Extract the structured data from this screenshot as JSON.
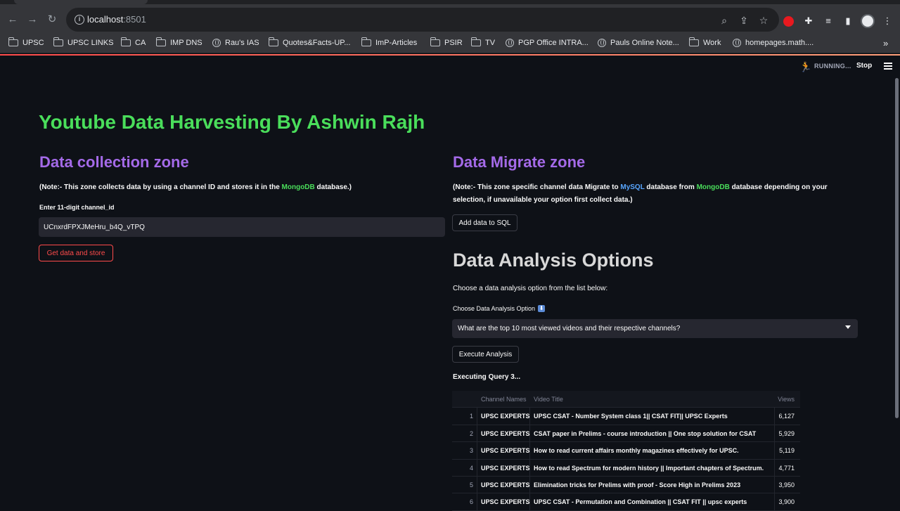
{
  "browser": {
    "url_host": "localhost",
    "url_port": ":8501",
    "bookmarks": [
      {
        "label": "UPSC",
        "icon": "folder-icon"
      },
      {
        "label": "UPSC LINKS",
        "icon": "folder-icon"
      },
      {
        "label": "CA",
        "icon": "folder-icon"
      },
      {
        "label": "IMP DNS",
        "icon": "folder-icon"
      },
      {
        "label": "Rau's IAS",
        "icon": "globe-icon"
      },
      {
        "label": "Quotes&Facts-UP...",
        "icon": "folder-icon"
      },
      {
        "label": "ImP-Articles",
        "icon": "folder-icon"
      },
      {
        "label": "PSIR",
        "icon": "folder-icon"
      },
      {
        "label": "TV",
        "icon": "folder-icon"
      },
      {
        "label": "PGP Office INTRA...",
        "icon": "globe-icon"
      },
      {
        "label": "Pauls Online Note...",
        "icon": "globe-icon"
      },
      {
        "label": "Work",
        "icon": "folder-icon"
      },
      {
        "label": "homepages.math....",
        "icon": "globe-icon"
      }
    ],
    "more_label": "»"
  },
  "status": {
    "running_label": "RUNNING...",
    "stop_label": "Stop"
  },
  "app": {
    "title": "Youtube Data Harvesting By Ashwin Rajh",
    "collection": {
      "heading": "Data collection zone",
      "note_prefix": "(Note:- This zone ",
      "note_b1": "collects data",
      "note_mid1": " by using a channel ID and ",
      "note_b2": "stores it in the",
      "note_space": " ",
      "note_mongo": "MongoDB",
      "note_suffix": " database.)",
      "input_label": "Enter 11-digit channel_id",
      "input_value": "UCnxrdFPXJMeHru_b4Q_vTPQ",
      "button_label": "Get data and store"
    },
    "migrate": {
      "heading": "Data Migrate zone",
      "note_prefix": "(Note:- This zone specific channel data ",
      "note_b1": "Migrate to",
      "note_space": " ",
      "note_mysql": "MySQL",
      "note_mid": " database from ",
      "note_mongo": "MongoDB",
      "note_suffix": " database depending on your selection, if unavailable your option first collect data.)",
      "button_label": "Add data to SQL"
    },
    "analysis": {
      "heading": "Data Analysis Options",
      "instruction": "Choose a data analysis option from the list below:",
      "select_label": "Choose Data Analysis Option",
      "select_emoji": "⬇",
      "selected_option": "What are the top 10 most viewed videos and their respective channels?",
      "execute_label": "Execute Analysis",
      "query_status": "Executing Query 3...",
      "table": {
        "columns": [
          "Channel Names",
          "Video Title",
          "Views"
        ],
        "rows": [
          {
            "idx": "1",
            "channel": "UPSC EXPERTS",
            "title": "UPSC CSAT - Number System class 1|| CSAT FIT|| UPSC Experts",
            "views": "6,127"
          },
          {
            "idx": "2",
            "channel": "UPSC EXPERTS",
            "title": "CSAT paper in Prelims - course introduction || One stop solution for CSAT",
            "views": "5,929"
          },
          {
            "idx": "3",
            "channel": "UPSC EXPERTS",
            "title": "How to read current affairs monthly magazines effectively for UPSC.",
            "views": "5,119"
          },
          {
            "idx": "4",
            "channel": "UPSC EXPERTS",
            "title": "How to read Spectrum for modern history || Important chapters of Spectrum.",
            "views": "4,771"
          },
          {
            "idx": "5",
            "channel": "UPSC EXPERTS",
            "title": "Elimination tricks for Prelims with proof - Score High in Prelims 2023",
            "views": "3,950"
          },
          {
            "idx": "6",
            "channel": "UPSC EXPERTS",
            "title": "UPSC CSAT - Permutation and Combination || CSAT FIT || upsc experts",
            "views": "3,900"
          }
        ]
      }
    }
  },
  "colors": {
    "background": "#0e1117",
    "title_green": "#4ade5b",
    "zone_purple": "#a46ae8",
    "accent_red": "#ff4b4b",
    "mysql_blue": "#58a6ff"
  }
}
